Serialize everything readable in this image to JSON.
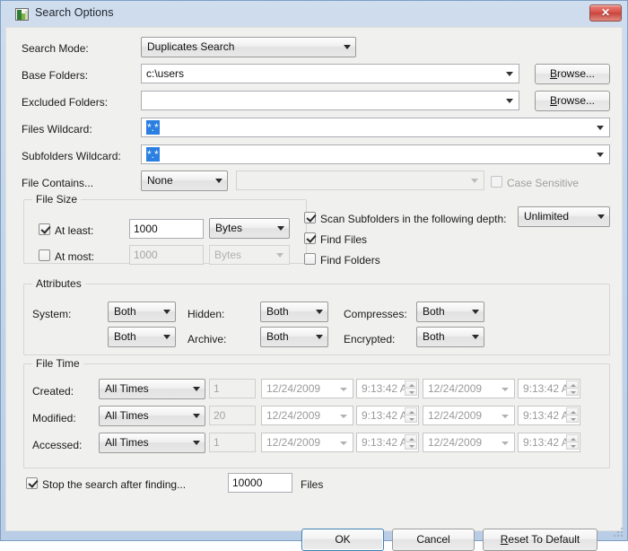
{
  "window": {
    "title": "Search Options",
    "app_icon": "app-icon",
    "close_label": "✕",
    "accent_color": "#3c7fb1",
    "titlebar_color": "#c3d5ea",
    "client_color": "#f0f0ee"
  },
  "search_mode": {
    "label": "Search Mode:",
    "value": "Duplicates Search"
  },
  "base_folders": {
    "label": "Base Folders:",
    "value": "c:\\users",
    "browse_label": "Browse...",
    "browse_accel": "B"
  },
  "excluded_folders": {
    "label": "Excluded Folders:",
    "value": "",
    "browse_label": "Browse...",
    "browse_accel": "B"
  },
  "files_wildcard": {
    "label": "Files Wildcard:",
    "value": "*.*",
    "selected": true
  },
  "subfolders_wildcard": {
    "label": "Subfolders Wildcard:",
    "value": "*.*",
    "selected": true
  },
  "file_contains": {
    "label": "File Contains...",
    "mode": "None",
    "text": "",
    "case_sensitive_label": "Case Sensitive",
    "case_sensitive_checked": false,
    "case_sensitive_enabled": false
  },
  "file_size": {
    "title": "File Size",
    "at_least": {
      "label": "At least:",
      "checked": true,
      "value": "1000",
      "unit": "Bytes"
    },
    "at_most": {
      "label": "At most:",
      "checked": false,
      "value": "1000",
      "unit": "Bytes"
    }
  },
  "scan_options": {
    "scan_subfolders_label": "Scan Subfolders in the following depth:",
    "scan_subfolders_checked": true,
    "depth_value": "Unlimited",
    "find_files_label": "Find Files",
    "find_files_checked": true,
    "find_folders_label": "Find Folders",
    "find_folders_checked": false
  },
  "attributes": {
    "title": "Attributes",
    "rows": [
      [
        {
          "label": "System:",
          "value": "Both"
        },
        {
          "label": "Hidden:",
          "value": "Both"
        },
        {
          "label": "Compresses:",
          "value": "Both"
        }
      ],
      [
        {
          "label": "",
          "value": "Both"
        },
        {
          "label": "Archive:",
          "value": "Both"
        },
        {
          "label": "Encrypted:",
          "value": "Both"
        }
      ]
    ]
  },
  "file_time": {
    "title": "File Time",
    "rows": [
      {
        "label": "Created:",
        "mode": "All Times",
        "amount": "1",
        "date_from": "12/24/2009",
        "time_from": "9:13:42 A",
        "date_to": "12/24/2009",
        "time_to": "9:13:42 A"
      },
      {
        "label": "Modified:",
        "mode": "All Times",
        "amount": "20",
        "date_from": "12/24/2009",
        "time_from": "9:13:42 A",
        "date_to": "12/24/2009",
        "time_to": "9:13:42 A"
      },
      {
        "label": "Accessed:",
        "mode": "All Times",
        "amount": "1",
        "date_from": "12/24/2009",
        "time_from": "9:13:42 A",
        "date_to": "12/24/2009",
        "time_to": "9:13:42 A"
      }
    ]
  },
  "stop_search": {
    "label": "Stop the search after finding...",
    "checked": true,
    "value": "10000",
    "suffix": "Files"
  },
  "footer": {
    "ok_label": "OK",
    "cancel_label": "Cancel",
    "reset_label": "Reset To Default",
    "reset_accel": "R"
  }
}
